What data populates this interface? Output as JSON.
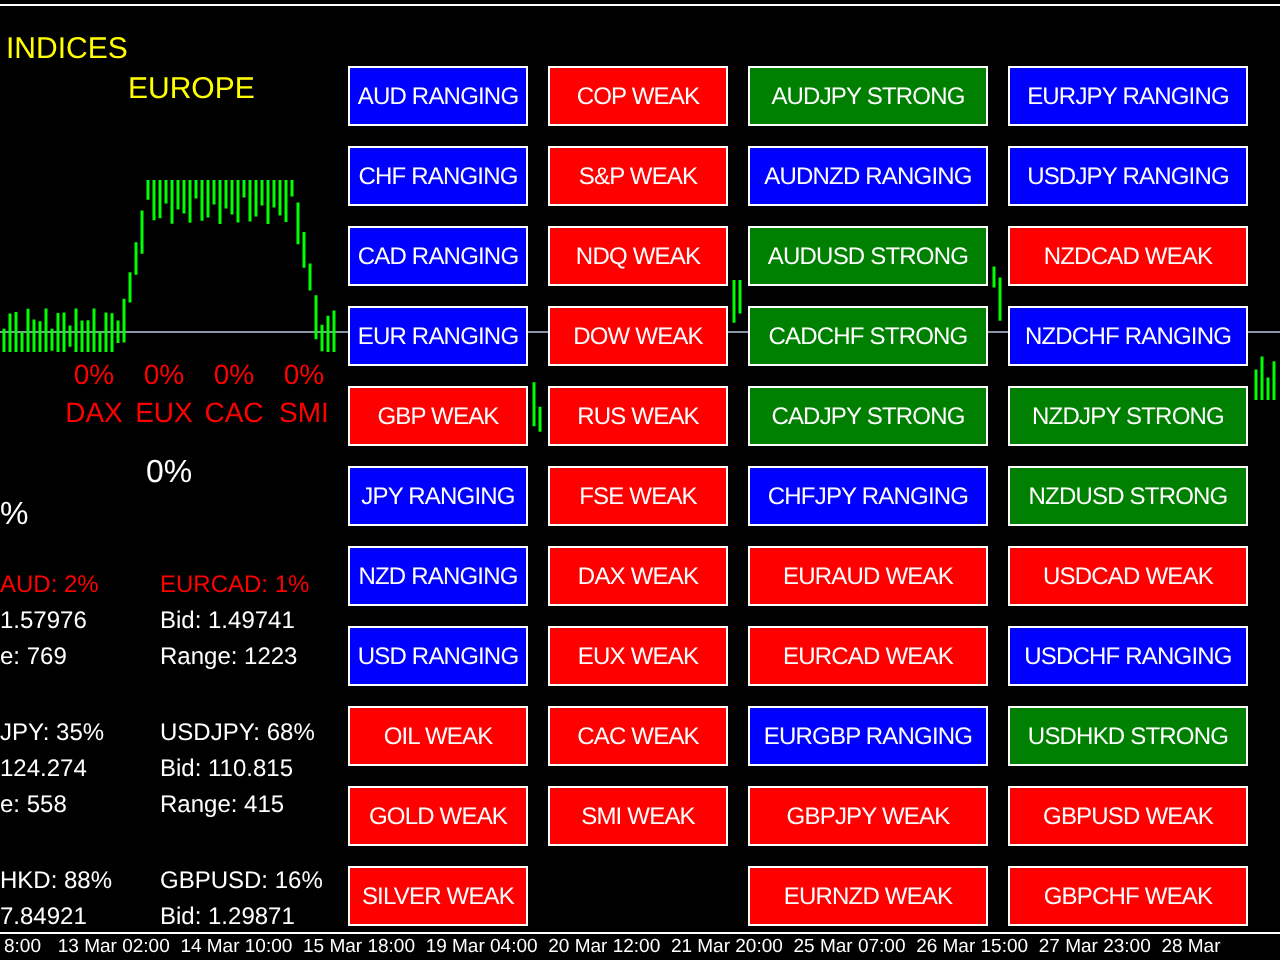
{
  "header": {
    "title": "INDICES",
    "subtitle": "EUROPE"
  },
  "indices": [
    {
      "percent": "0%",
      "name": "DAX"
    },
    {
      "percent": "0%",
      "name": "EUX"
    },
    {
      "percent": "0%",
      "name": "CAC"
    },
    {
      "percent": "0%",
      "name": "SMI"
    }
  ],
  "total": "0%",
  "partial": "%",
  "stats": [
    {
      "title": "AUD: 2%",
      "color": "#ff0000",
      "lines": [
        "1.57976",
        "e: 769"
      ]
    },
    {
      "title": "EURCAD: 1%",
      "color": "#ff0000",
      "lines": [
        "Bid: 1.49741",
        "Range: 1223"
      ]
    },
    {
      "title": "JPY: 35%",
      "color": "#ffffff",
      "lines": [
        "124.274",
        "e: 558"
      ]
    },
    {
      "title": "USDJPY: 68%",
      "color": "#ffffff",
      "lines": [
        "Bid: 110.815",
        "Range: 415"
      ]
    },
    {
      "title": "HKD: 88%",
      "color": "#ffffff",
      "lines": [
        "7.84921"
      ]
    },
    {
      "title": "GBPUSD: 16%",
      "color": "#ffffff",
      "lines": [
        "Bid: 1.29871"
      ]
    }
  ],
  "signals": [
    [
      {
        "label": "AUD RANGING",
        "kind": "ranging"
      },
      {
        "label": "CHF RANGING",
        "kind": "ranging"
      },
      {
        "label": "CAD RANGING",
        "kind": "ranging"
      },
      {
        "label": "EUR RANGING",
        "kind": "ranging"
      },
      {
        "label": "GBP WEAK",
        "kind": "weak"
      },
      {
        "label": "JPY RANGING",
        "kind": "ranging"
      },
      {
        "label": "NZD RANGING",
        "kind": "ranging"
      },
      {
        "label": "USD RANGING",
        "kind": "ranging"
      },
      {
        "label": "OIL WEAK",
        "kind": "weak"
      },
      {
        "label": "GOLD WEAK",
        "kind": "weak"
      },
      {
        "label": "SILVER WEAK",
        "kind": "weak"
      }
    ],
    [
      {
        "label": "COP WEAK",
        "kind": "weak"
      },
      {
        "label": "S&P WEAK",
        "kind": "weak"
      },
      {
        "label": "NDQ WEAK",
        "kind": "weak"
      },
      {
        "label": "DOW WEAK",
        "kind": "weak"
      },
      {
        "label": "RUS WEAK",
        "kind": "weak"
      },
      {
        "label": "FSE WEAK",
        "kind": "weak"
      },
      {
        "label": "DAX WEAK",
        "kind": "weak"
      },
      {
        "label": "EUX WEAK",
        "kind": "weak"
      },
      {
        "label": "CAC WEAK",
        "kind": "weak"
      },
      {
        "label": "SMI WEAK",
        "kind": "weak"
      }
    ],
    [
      {
        "label": "AUDJPY STRONG",
        "kind": "strong"
      },
      {
        "label": "AUDNZD RANGING",
        "kind": "ranging"
      },
      {
        "label": "AUDUSD STRONG",
        "kind": "strong"
      },
      {
        "label": "CADCHF STRONG",
        "kind": "strong"
      },
      {
        "label": "CADJPY STRONG",
        "kind": "strong"
      },
      {
        "label": "CHFJPY RANGING",
        "kind": "ranging"
      },
      {
        "label": "EURAUD WEAK",
        "kind": "weak"
      },
      {
        "label": "EURCAD WEAK",
        "kind": "weak"
      },
      {
        "label": "EURGBP RANGING",
        "kind": "ranging"
      },
      {
        "label": "GBPJPY WEAK",
        "kind": "weak"
      },
      {
        "label": "EURNZD WEAK",
        "kind": "weak"
      }
    ],
    [
      {
        "label": "EURJPY RANGING",
        "kind": "ranging"
      },
      {
        "label": "USDJPY RANGING",
        "kind": "ranging"
      },
      {
        "label": "NZDCAD WEAK",
        "kind": "weak"
      },
      {
        "label": "NZDCHF RANGING",
        "kind": "ranging"
      },
      {
        "label": "NZDJPY STRONG",
        "kind": "strong"
      },
      {
        "label": "NZDUSD STRONG",
        "kind": "strong"
      },
      {
        "label": "USDCAD WEAK",
        "kind": "weak"
      },
      {
        "label": "USDCHF RANGING",
        "kind": "ranging"
      },
      {
        "label": "USDHKD STRONG",
        "kind": "strong"
      },
      {
        "label": "GBPUSD WEAK",
        "kind": "weak"
      },
      {
        "label": "GBPCHF WEAK",
        "kind": "weak"
      }
    ]
  ],
  "time_axis": [
    "8:00",
    "13 Mar 02:00",
    "14 Mar 10:00",
    "15 Mar 18:00",
    "19 Mar 04:00",
    "20 Mar 12:00",
    "21 Mar 20:00",
    "25 Mar 07:00",
    "26 Mar 15:00",
    "27 Mar 23:00",
    "28 Mar"
  ]
}
